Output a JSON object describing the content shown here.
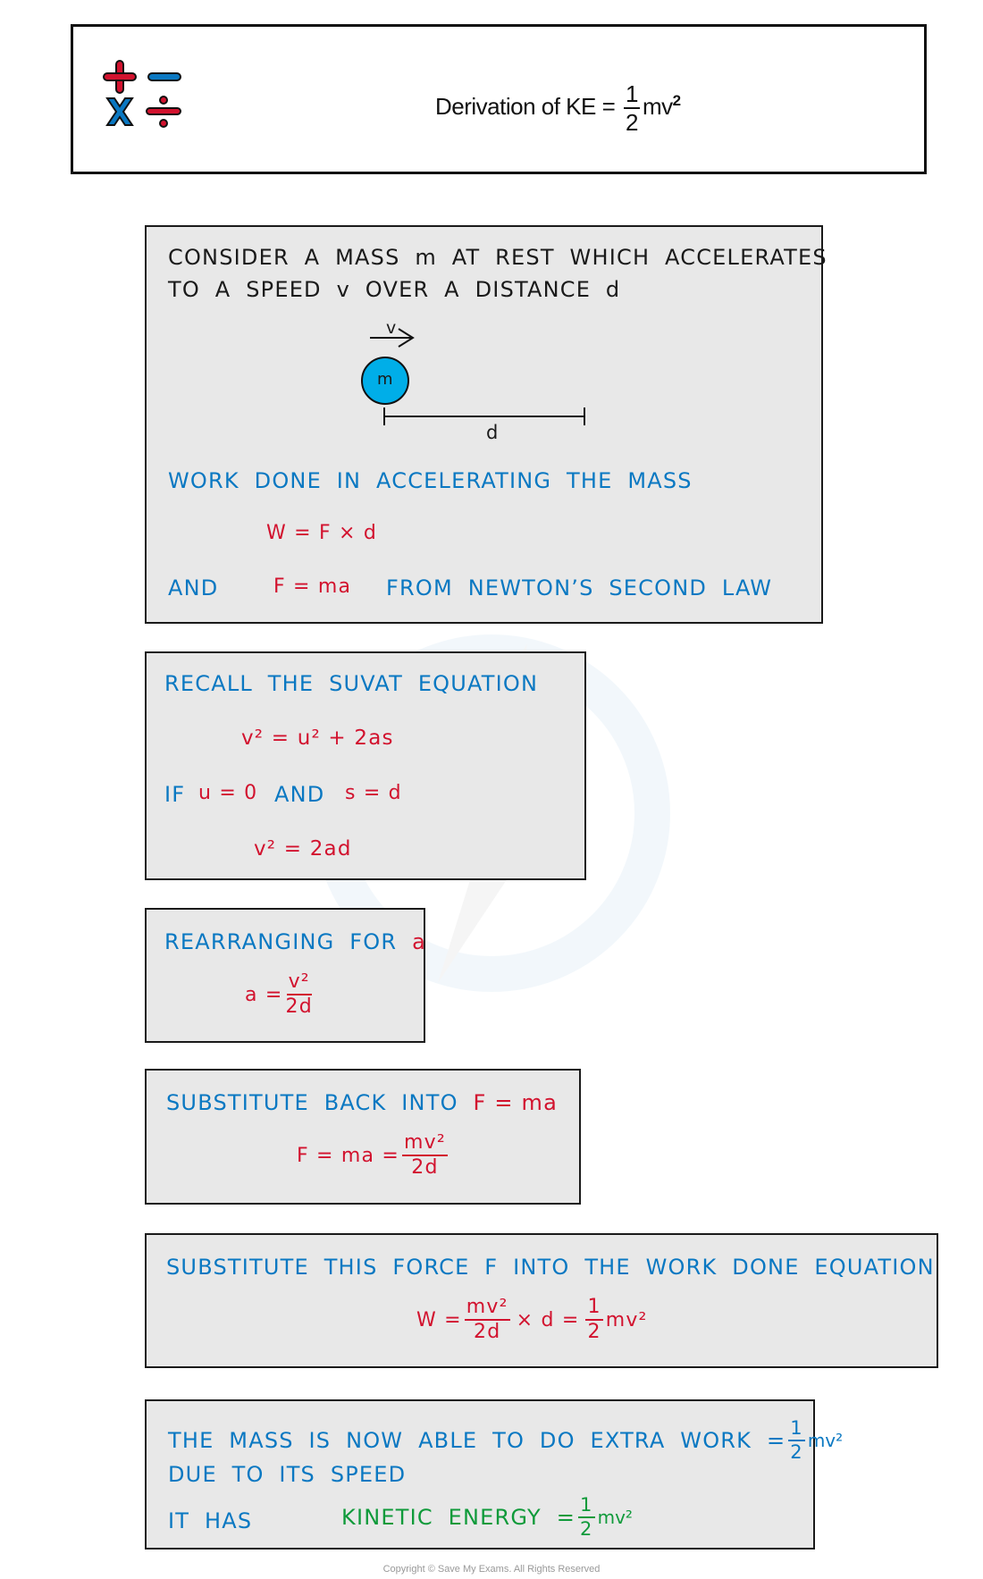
{
  "header": {
    "icon_name": "math-operators-icon",
    "title_prefix": "Derivation of  KE =",
    "title_frac_num": "1",
    "title_frac_den": "2",
    "title_suffix": "mv",
    "title_sup": "2"
  },
  "box1": {
    "line1": "CONSIDER A MASS m AT REST WHICH ACCELERATES",
    "line2": "TO A SPEED v OVER A DISTANCE d",
    "diagram": {
      "velocity_label": "v",
      "mass_label": "m",
      "distance_label": "d",
      "mass_color": "#00aee8"
    },
    "work_heading": "WORK DONE IN ACCELERATING THE MASS",
    "work_equation": "W = F × d",
    "and_label": "AND",
    "newton_equation": "F = ma",
    "newton_text": "FROM NEWTON’S SECOND LAW"
  },
  "box2": {
    "heading": "RECALL THE SUVAT EQUATION",
    "suvat": "v² = u² + 2as",
    "if_label": "IF",
    "cond1": "u = 0",
    "and_label": "AND",
    "cond2": "s = d",
    "result": "v² = 2ad"
  },
  "box3": {
    "heading": "REARRANGING FOR",
    "heading_var": "a",
    "lhs": "a =",
    "num": "v²",
    "den": "2d"
  },
  "box4": {
    "heading": "SUBSTITUTE BACK INTO",
    "heading_eq": "F = ma",
    "lhs": "F = ma =",
    "num": "mv²",
    "den": "2d"
  },
  "box5": {
    "heading": "SUBSTITUTE THIS FORCE F INTO THE WORK DONE EQUATION",
    "lhs": "W =",
    "num1": "mv²",
    "den1": "2d",
    "mid": "× d =",
    "num2": "1",
    "den2": "2",
    "tail": "mv²"
  },
  "box6": {
    "line1": "THE MASS IS NOW ABLE TO DO EXTRA WORK =",
    "line1_num": "1",
    "line1_den": "2",
    "line1_tail": "mv²",
    "line2": "DUE TO ITS SPEED",
    "it_has": "IT HAS",
    "ke_label": "KINETIC ENERGY =",
    "ke_num": "1",
    "ke_den": "2",
    "ke_tail": "mv²"
  },
  "colors": {
    "text_blue": "#0a78c2",
    "equation_red": "#d2122e",
    "highlight_green": "#0f9a3a",
    "box_fill": "#e8e8e8"
  },
  "footer": {
    "copyright": "Copyright © Save My Exams. All Rights Reserved"
  }
}
